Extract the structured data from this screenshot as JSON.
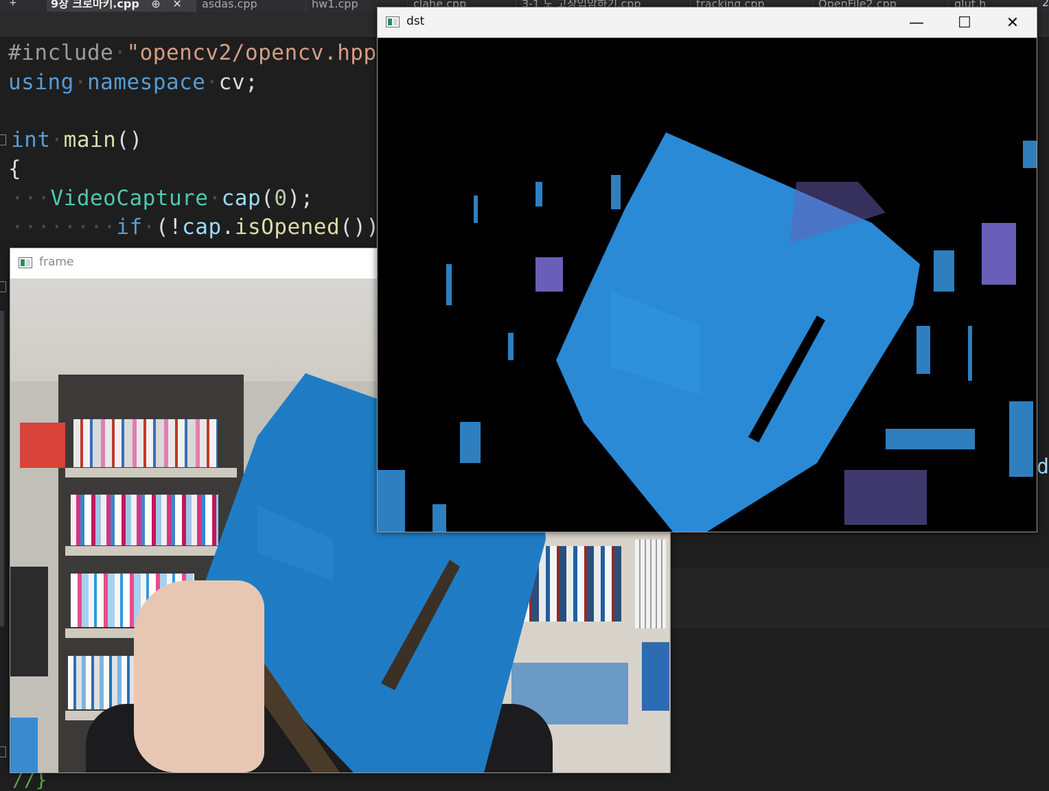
{
  "ide": {
    "tabs": [
      {
        "label": "9장 크로마키.cpp",
        "active": true
      },
      {
        "label": "asdas.cpp"
      },
      {
        "label": "hw1.cpp"
      },
      {
        "label": "clahe.cpp"
      },
      {
        "label": "3-1 도 고장입암하기.cpp"
      },
      {
        "label": "tracking.cpp"
      },
      {
        "label": "OpenFile2.cpp"
      },
      {
        "label": "glut.h"
      }
    ],
    "pin_glyph": "⊕",
    "close_glyph": "✕",
    "edge_number": "2",
    "edge_char": "d",
    "bottom_code": "//}",
    "code": {
      "l1_directive": "#include",
      "l1_string": "\"opencv2/opencv.hpp\"",
      "l2_using": "using",
      "l2_namespace": "namespace",
      "l2_cv": "cv;",
      "l3_int": "int",
      "l3_main": "main",
      "l3_parens": "()",
      "l4_brace": "{",
      "l5_type": "VideoCapture",
      "l5_var": "cap",
      "l5_open": "(",
      "l5_num": "0",
      "l5_close": ");",
      "l6_if": "if",
      "l6_open": "(!",
      "l6_var": "cap",
      "l6_dot": ".",
      "l6_fn": "isOpened",
      "l6_close": "())"
    }
  },
  "windows": {
    "dst": {
      "title": "dst",
      "minimize": "—",
      "maximize": "☐",
      "close": "✕"
    },
    "frame": {
      "title": "frame"
    }
  },
  "colors": {
    "box_blue": "#1f7cc4",
    "keyword": "#569cd6",
    "string": "#d69d85",
    "type": "#4ec9b0"
  }
}
